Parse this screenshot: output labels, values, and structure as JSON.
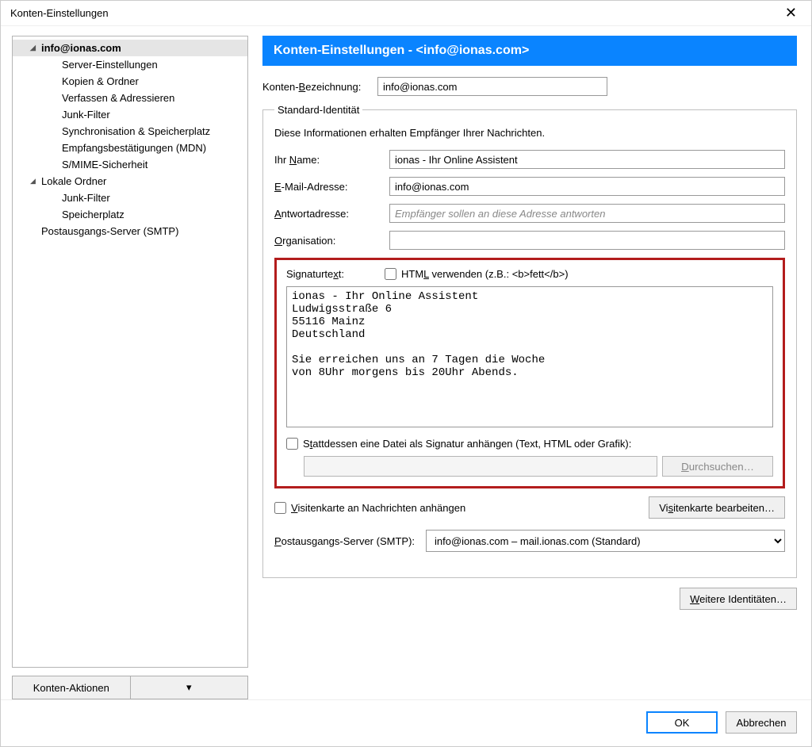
{
  "window": {
    "title": "Konten-Einstellungen"
  },
  "tree": {
    "items": [
      {
        "label": "info@ionas.com",
        "level": 1,
        "expandable": true,
        "selected": true
      },
      {
        "label": "Server-Einstellungen",
        "level": 2
      },
      {
        "label": "Kopien & Ordner",
        "level": 2
      },
      {
        "label": "Verfassen & Adressieren",
        "level": 2
      },
      {
        "label": "Junk-Filter",
        "level": 2
      },
      {
        "label": "Synchronisation & Speicherplatz",
        "level": 2
      },
      {
        "label": "Empfangsbestätigungen (MDN)",
        "level": 2
      },
      {
        "label": "S/MIME-Sicherheit",
        "level": 2
      },
      {
        "label": "Lokale Ordner",
        "level": 1,
        "expandable": true
      },
      {
        "label": "Junk-Filter",
        "level": 2
      },
      {
        "label": "Speicherplatz",
        "level": 2
      },
      {
        "label": "Postausgangs-Server (SMTP)",
        "level": 1
      }
    ],
    "actions_label": "Konten-Aktionen"
  },
  "page": {
    "header": "Konten-Einstellungen -  <info@ionas.com>",
    "account_label": "Konten-Bezeichnung:",
    "account_value": "info@ionas.com",
    "identity": {
      "legend": "Standard-Identität",
      "desc": "Diese Informationen erhalten Empfänger Ihrer Nachrichten.",
      "name_label": "Ihr Name:",
      "name_value": "ionas - Ihr Online Assistent",
      "email_label": "E-Mail-Adresse:",
      "email_value": "info@ionas.com",
      "reply_label": "Antwortadresse:",
      "reply_placeholder": "Empfänger sollen an diese Adresse antworten",
      "org_label": "Organisation:"
    },
    "signature": {
      "label": "Signaturtext:",
      "use_html_label": "HTML verwenden (z.B.: <b>fett</b>)",
      "text": "ionas - Ihr Online Assistent\nLudwigsstraße 6\n55116 Mainz\nDeutschland\n\nSie erreichen uns an 7 Tagen die Woche\nvon 8Uhr morgens bis 20Uhr Abends.",
      "file_label": "Stattdessen eine Datei als Signatur anhängen (Text, HTML oder Grafik):",
      "browse_label": "Durchsuchen…"
    },
    "vcard": {
      "attach_label": "Visitenkarte an Nachrichten anhängen",
      "edit_label": "Visitenkarte bearbeiten…"
    },
    "smtp": {
      "label": "Postausgangs-Server (SMTP):",
      "selected": "info@ionas.com – mail.ionas.com (Standard)"
    },
    "more_identities": "Weitere Identitäten…"
  },
  "dialog": {
    "ok": "OK",
    "cancel": "Abbrechen"
  }
}
